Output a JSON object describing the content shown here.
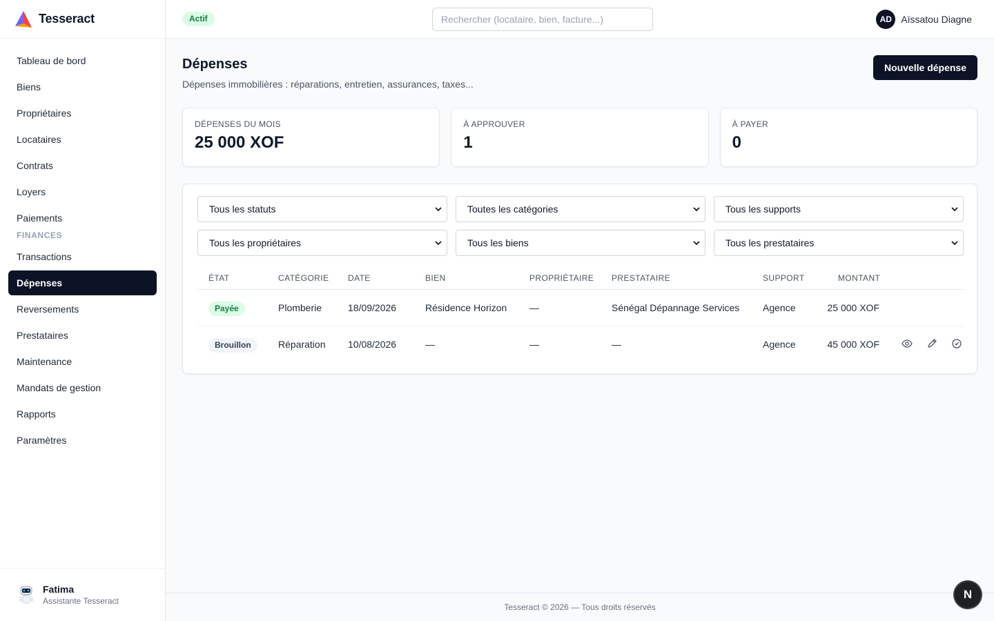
{
  "app": {
    "name": "Tesseract"
  },
  "sidebar": {
    "items": [
      {
        "label": "Tableau de bord"
      },
      {
        "label": "Biens"
      },
      {
        "label": "Propriétaires"
      },
      {
        "label": "Locataires"
      },
      {
        "label": "Contrats"
      },
      {
        "label": "Loyers"
      },
      {
        "label": "Paiements"
      }
    ],
    "section_label": "FINANCES",
    "finance_items": [
      {
        "label": "Transactions"
      },
      {
        "label": "Dépenses",
        "active": true
      },
      {
        "label": "Reversements"
      },
      {
        "label": "Prestataires"
      },
      {
        "label": "Maintenance"
      },
      {
        "label": "Mandats de gestion"
      },
      {
        "label": "Rapports"
      },
      {
        "label": "Paramètres"
      }
    ],
    "assistant": {
      "name": "Fatima",
      "role": "Assistante Tesseract"
    }
  },
  "topbar": {
    "status": "Actif",
    "search_placeholder": "Rechercher (locataire, bien, facture...)",
    "user": {
      "initials": "AD",
      "name": "Aïssatou Diagne"
    }
  },
  "page": {
    "title": "Dépenses",
    "subtitle": "Dépenses immobilières : réparations, entretien, assurances, taxes...",
    "new_button": "Nouvelle dépense"
  },
  "stats": [
    {
      "label": "DÉPENSES DU MOIS",
      "value": "25 000 XOF"
    },
    {
      "label": "À APPROUVER",
      "value": "1"
    },
    {
      "label": "À PAYER",
      "value": "0"
    }
  ],
  "filters": [
    "Tous les statuts",
    "Toutes les catégories",
    "Tous les supports",
    "Tous les propriétaires",
    "Tous les biens",
    "Tous les prestataires"
  ],
  "table": {
    "columns": [
      "ÉTAT",
      "CATÉGORIE",
      "DATE",
      "BIEN",
      "PROPRIÉTAIRE",
      "PRESTATAIRE",
      "SUPPORT",
      "MONTANT"
    ],
    "rows": [
      {
        "etat": "Payée",
        "categorie": "Plomberie",
        "date": "18/09/2026",
        "bien": "Résidence Horizon",
        "proprietaire": "—",
        "prestataire": "Sénégal Dépannage Services",
        "support": "Agence",
        "montant": "25 000 XOF"
      },
      {
        "etat": "Brouillon",
        "categorie": "Réparation",
        "date": "10/08/2026",
        "bien": "—",
        "proprietaire": "—",
        "prestataire": "—",
        "support": "Agence",
        "montant": "45 000 XOF"
      }
    ]
  },
  "colors": {
    "accent": "#0b1324",
    "paid_bg": "#dcfce7",
    "paid_fg": "#15803d",
    "draft_bg": "#f1f5f9",
    "draft_fg": "#334155"
  },
  "icons": {
    "view": "eye-icon",
    "edit": "pencil-icon",
    "approve": "check-circle-icon"
  },
  "footer": {
    "text": "Tesseract © 2026 — Tous droits réservés"
  },
  "fab": {
    "label": "N"
  }
}
